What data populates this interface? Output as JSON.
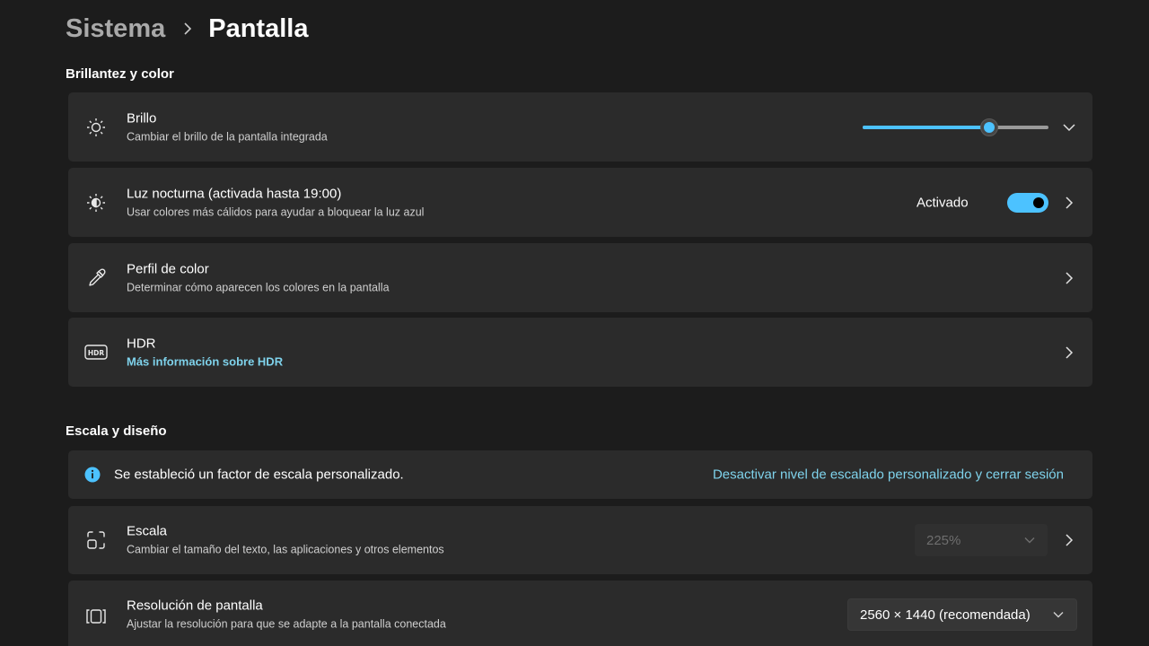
{
  "breadcrumb": {
    "parent": "Sistema",
    "current": "Pantalla"
  },
  "colors": {
    "accent": "#4cc2ff",
    "link": "#7fd3ec",
    "card_bg": "#2b2b2b",
    "page_bg": "#1c1c1c"
  },
  "sections": {
    "brightness_color": "Brillantez y color",
    "scale_layout": "Escala y diseño"
  },
  "brightness": {
    "title": "Brillo",
    "desc": "Cambiar el brillo de la pantalla integrada",
    "icon": "sun-icon",
    "value_fraction": 0.68
  },
  "night_light": {
    "title": "Luz nocturna (activada hasta 19:00)",
    "desc": "Usar colores más cálidos para ayudar a bloquear la luz azul",
    "icon": "night-light-icon",
    "state_label": "Activado",
    "on": true
  },
  "color_profile": {
    "title": "Perfil de color",
    "desc": "Determinar cómo aparecen los colores en la pantalla",
    "icon": "eyedropper-icon"
  },
  "hdr": {
    "title": "HDR",
    "link": "Más información sobre HDR",
    "icon": "hdr-icon"
  },
  "scale_notice": {
    "text": "Se estableció un factor de escala personalizado.",
    "link": "Desactivar nivel de escalado personalizado y cerrar sesión",
    "icon": "info-icon"
  },
  "scale": {
    "title": "Escala",
    "desc": "Cambiar el tamaño del texto, las aplicaciones y otros elementos",
    "icon": "scale-icon",
    "value": "225%",
    "disabled": true
  },
  "resolution": {
    "title": "Resolución de pantalla",
    "desc": "Ajustar la resolución para que se adapte a la pantalla conectada",
    "icon": "resolution-icon",
    "value": "2560 × 1440 (recomendada)"
  }
}
